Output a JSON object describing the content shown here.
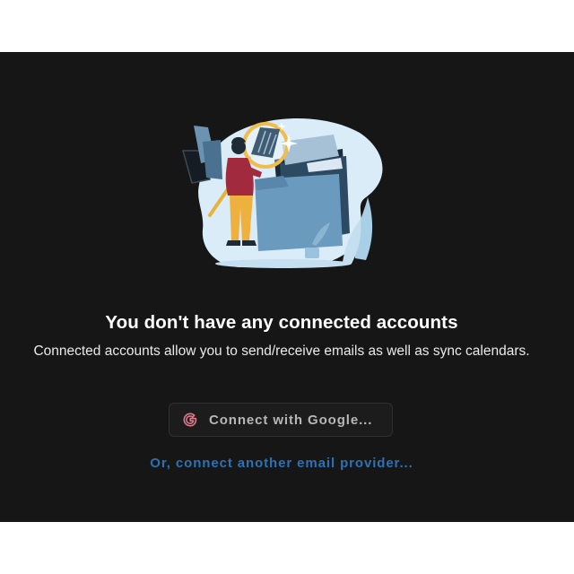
{
  "empty_state": {
    "title": "You don't have any connected accounts",
    "subtitle": "Connected accounts allow you to send/receive emails as well as sync calendars.",
    "illustration_icon": "person-searching-folders-illustration"
  },
  "actions": {
    "google_button_label": "Connect with Google...",
    "google_icon": "google-g-icon",
    "other_provider_link": "Or, connect another email provider..."
  },
  "colors": {
    "background": "#161617",
    "link": "#2c72b3",
    "google_icon": "#e07a8a"
  }
}
